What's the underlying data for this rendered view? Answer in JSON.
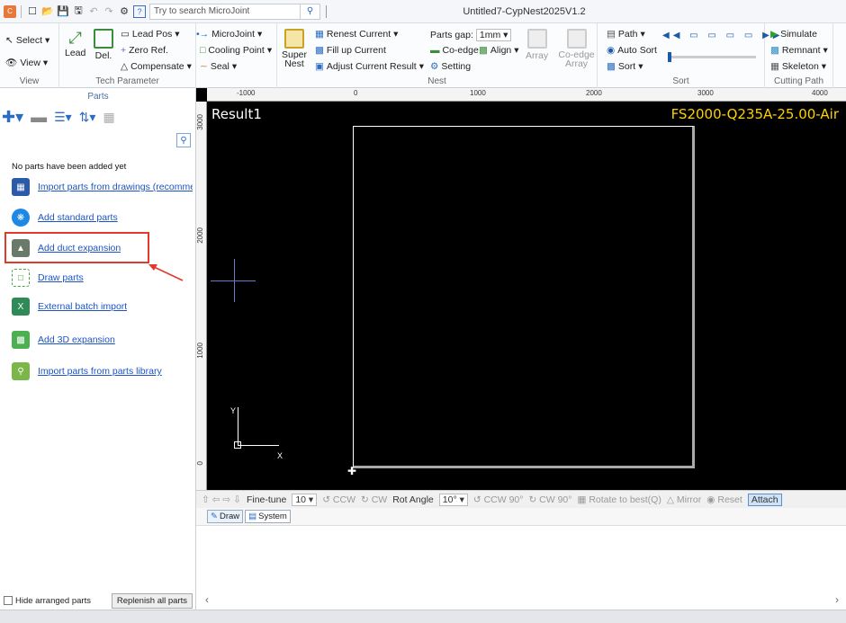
{
  "titlebar": {
    "search_placeholder": "Try to search MicroJoint",
    "window_title": "Untitled7-CypNest2025V1.2"
  },
  "ribbon": {
    "view_group": {
      "label": "View",
      "select": "Select",
      "view": "View"
    },
    "tech_group": {
      "label": "Tech Parameter",
      "lead": "Lead",
      "del": "Del.",
      "lead_pos": "Lead Pos",
      "zero_ref": "Zero Ref.",
      "compensate": "Compensate",
      "microjoint": "MicroJoint",
      "cooling_point": "Cooling Point",
      "seal": "Seal"
    },
    "nest_group": {
      "label": "Nest",
      "super_nest": "Super Nest",
      "renest_current": "Renest Current",
      "fill_up_current": "Fill up Current",
      "adjust_current_result": "Adjust Current Result",
      "parts_gap_label": "Parts gap:",
      "parts_gap_value": "1mm",
      "co_edge": "Co-edge",
      "align": "Align",
      "setting": "Setting",
      "array": "Array",
      "co_edge_array": "Co-edge Array"
    },
    "sort_group": {
      "label": "Sort",
      "path": "Path",
      "auto_sort": "Auto Sort",
      "sort": "Sort"
    },
    "cutting_group": {
      "label": "Cutting Path",
      "simulate": "Simulate",
      "remnant": "Remnant",
      "skeleton": "Skeleton"
    }
  },
  "left_panel": {
    "tab": "Parts",
    "no_parts": "No parts have been added yet",
    "items": [
      {
        "label": "Import parts from drawings (recommended)",
        "icon": "import-drawing-icon",
        "color": "#2a5aa8"
      },
      {
        "label": "Add standard parts",
        "icon": "standard-parts-icon",
        "color": "#1e88e5"
      },
      {
        "label": "Add duct expansion",
        "icon": "duct-expansion-icon",
        "color": "#6a7a6a"
      },
      {
        "label": "Draw parts",
        "icon": "draw-parts-icon",
        "color": "#47a447"
      },
      {
        "label": "External batch import",
        "icon": "batch-import-icon",
        "color": "#2e8b57"
      },
      {
        "label": "Add 3D expansion",
        "icon": "3d-expansion-icon",
        "color": "#4caf50"
      },
      {
        "label": "Import parts from parts library",
        "icon": "parts-library-icon",
        "color": "#7ab648"
      }
    ],
    "hide_arranged": "Hide arranged parts",
    "replenish_all": "Replenish all parts"
  },
  "canvas": {
    "result_title": "Result1",
    "material": "FS2000-Q235A-25.00-Air",
    "ruler_top": [
      "-1000",
      "0",
      "1000",
      "2000",
      "3000",
      "4000"
    ],
    "ruler_left": [
      "3000",
      "2000",
      "1000",
      "0"
    ],
    "axis_y": "Y",
    "axis_x": "X"
  },
  "finetune": {
    "label": "Fine-tune",
    "value": "10",
    "ccw": "CCW",
    "cw": "CW",
    "rot_angle_label": "Rot Angle",
    "rot_angle_value": "10°",
    "ccw90": "CCW 90°",
    "cw90": "CW 90°",
    "rotate_best": "Rotate to best(Q)",
    "mirror": "Mirror",
    "reset": "Reset",
    "attach": "Attach"
  },
  "bottom_tabs": [
    "Draw",
    "System"
  ],
  "colors": {
    "accent": "#2b6cc4",
    "highlight_box": "#e23a2a",
    "material_text": "#ffd000"
  }
}
